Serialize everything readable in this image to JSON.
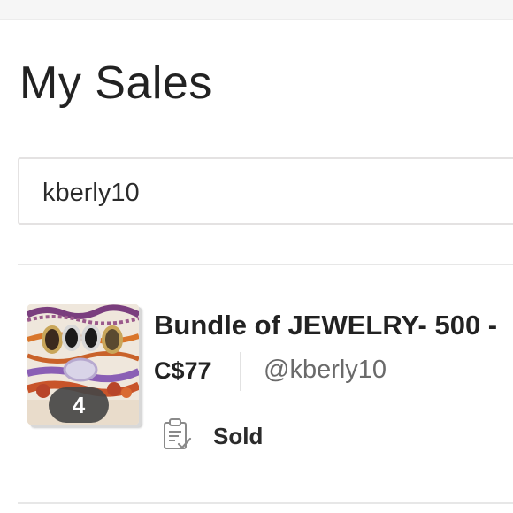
{
  "page": {
    "title": "My Sales"
  },
  "search": {
    "value": "kberly10"
  },
  "listing": {
    "title": "Bundle of JEWELRY- 500 -",
    "price": "C$77",
    "seller": "@kberly10",
    "image_count": "4",
    "status": "Sold",
    "status_icon": "clipboard-check-icon",
    "thumbnail": "jewelry-bundle-photo"
  }
}
